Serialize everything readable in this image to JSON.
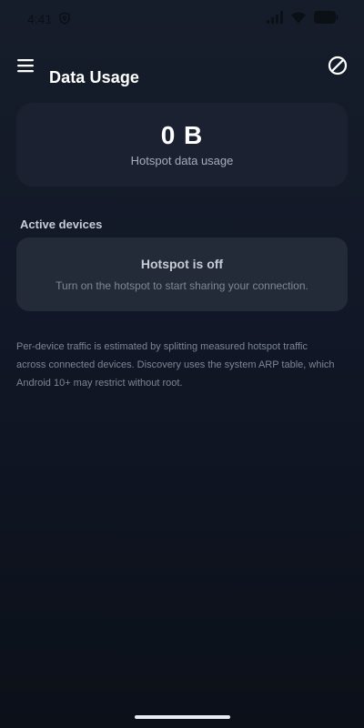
{
  "status_bar": {
    "time": "4:41"
  },
  "app_bar": {
    "title": "Data Usage"
  },
  "usage": {
    "value": "0 B",
    "label": "Hotspot data usage"
  },
  "active_devices": {
    "heading": "Active devices",
    "empty_title": "Hotspot is off",
    "empty_message": "Turn on the hotspot to start sharing your connection."
  },
  "footnote": "Per-device traffic is estimated by splitting measured hotspot traffic across connected devices. Discovery uses the system ARP table, which Android 10+ may restrict without root.",
  "icons": {
    "menu": "hamburger-menu-icon",
    "block": "block-icon",
    "vpn": "vpn-key-icon",
    "signal": "cellular-signal-icon",
    "wifi": "wifi-icon",
    "battery": "battery-icon"
  },
  "colors": {
    "background": "#111726",
    "card": "#1b2130",
    "muted_card": "#232b39",
    "primary_text": "#ffffff",
    "secondary_text": "#a6adba"
  }
}
